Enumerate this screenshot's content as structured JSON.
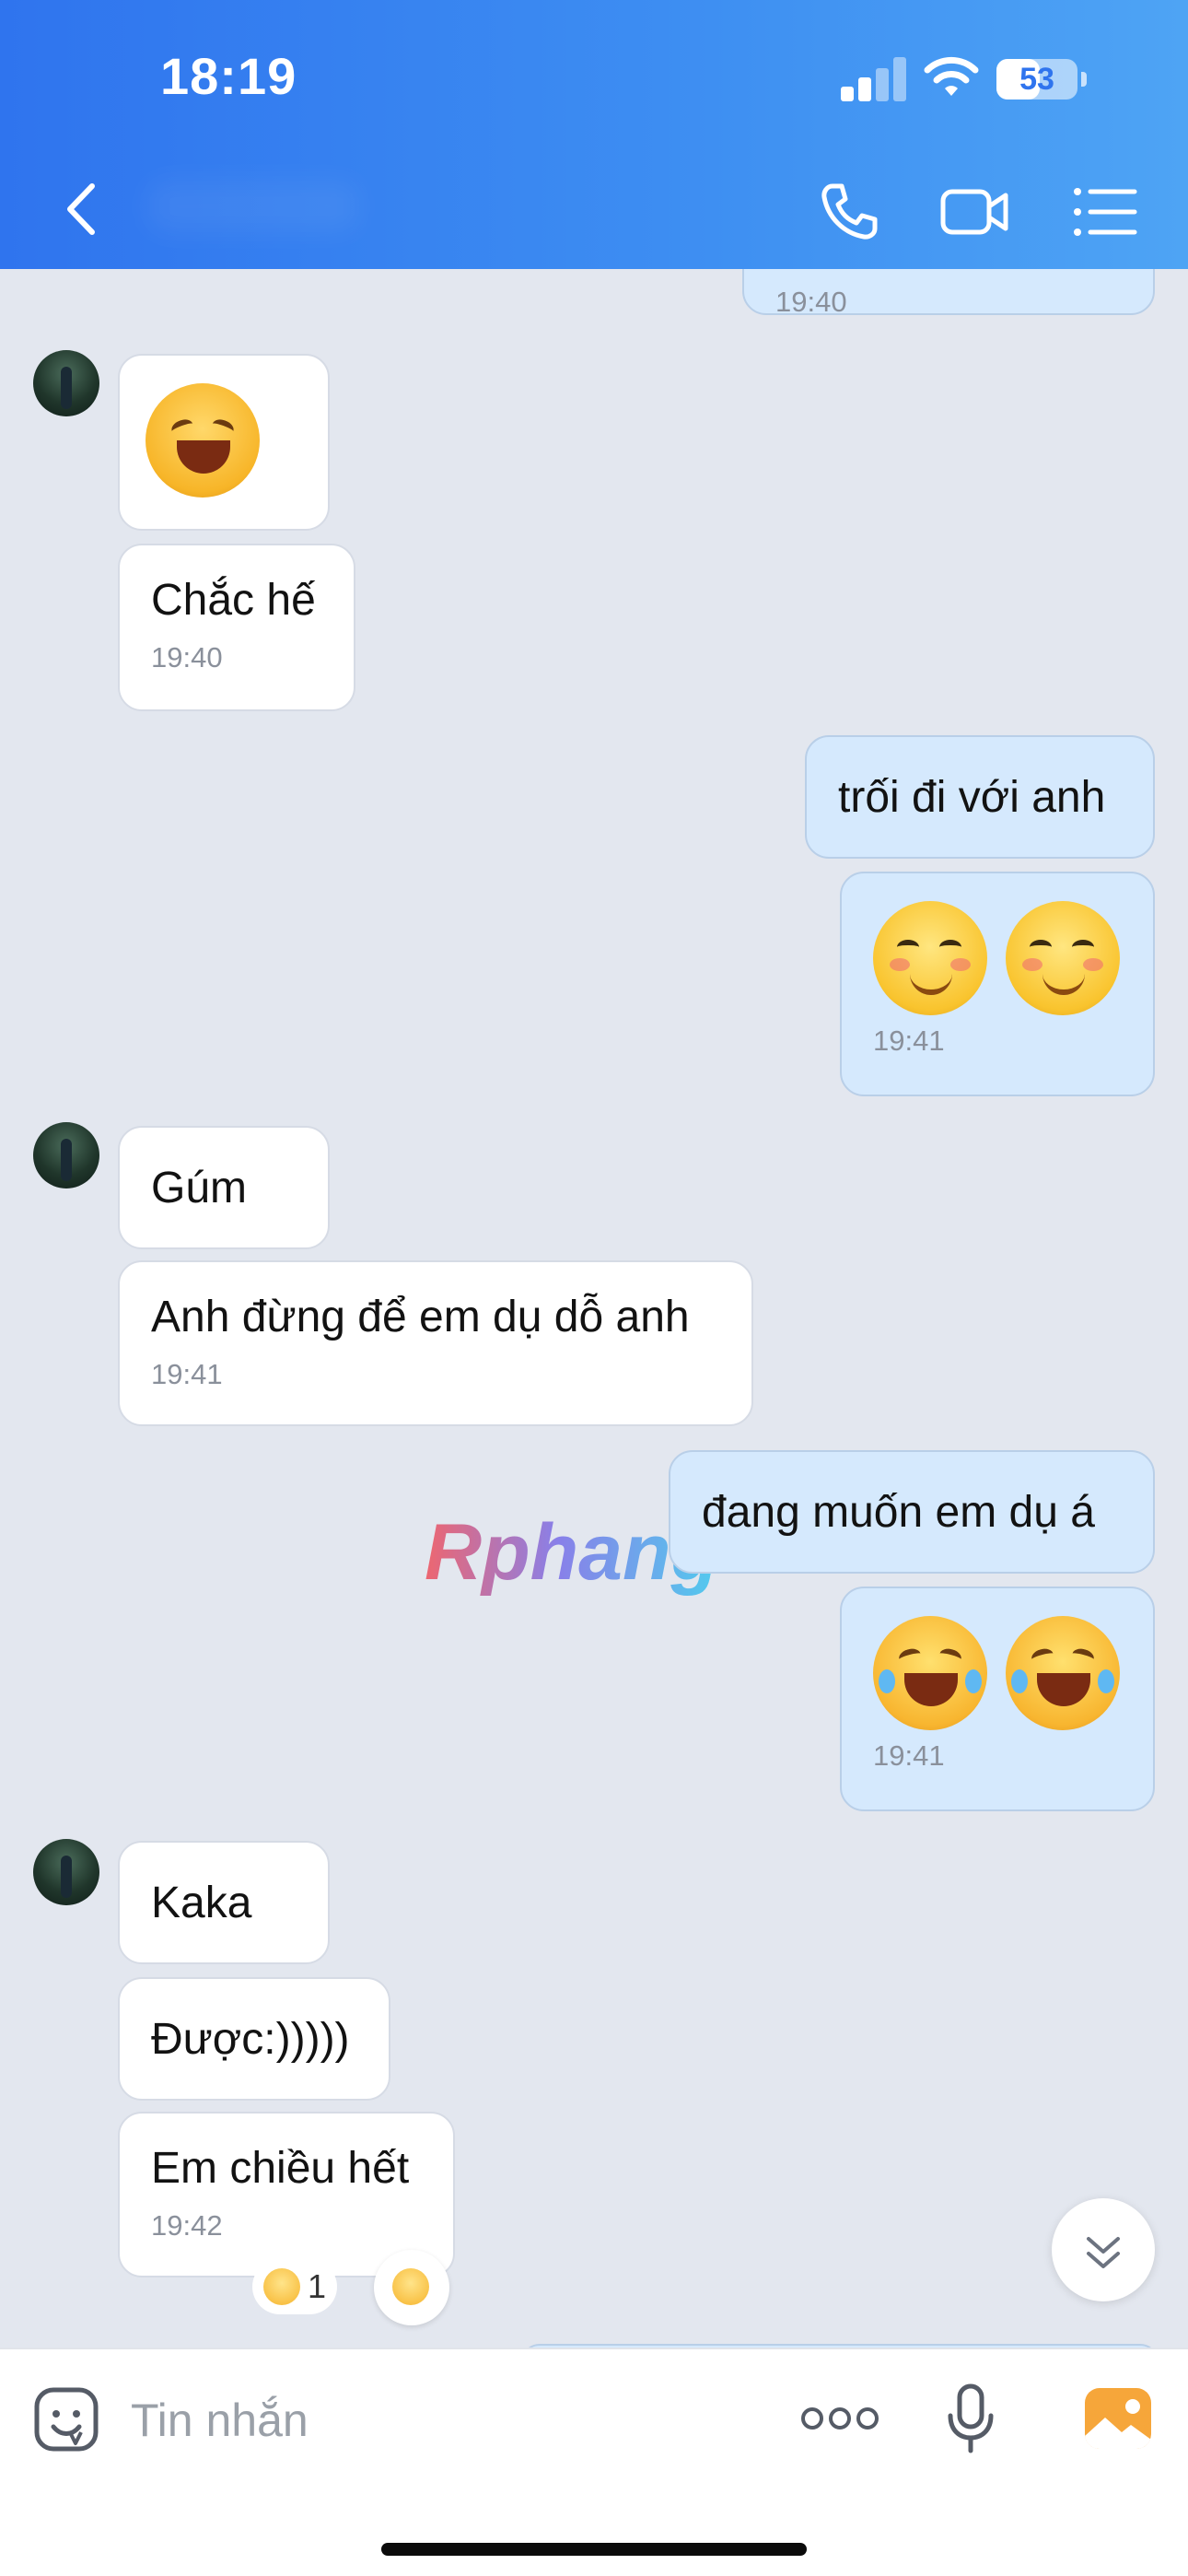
{
  "status_bar": {
    "time": "18:19",
    "battery": "53",
    "battery_level": 0.53
  },
  "header": {
    "contact_name": ""
  },
  "messages": [
    {
      "time": "19:40"
    },
    {
      "time": "19:40",
      "text": "Chắc hế"
    },
    {
      "text": "trối đi với anh"
    },
    {
      "time": "19:41"
    },
    {
      "text": "Gúm"
    },
    {
      "text": "Anh đừng để em dụ dỗ anh",
      "time": "19:41"
    },
    {
      "text": "đang muốn em dụ á"
    },
    {
      "time": "19:41"
    },
    {
      "text": "Kaka"
    },
    {
      "text": "Được:)))))"
    },
    {
      "text": "Em chiều hết",
      "time": "19:42"
    }
  ],
  "reaction": {
    "count": "1",
    "icon": "astonished-emoji-icon"
  },
  "watermark": "Rphang",
  "input": {
    "placeholder": "Tin nhắn",
    "value": ""
  },
  "colors": {
    "header_start": "#2f74ee",
    "header_end": "#4ea4f4",
    "outgoing_bubble": "#d5e9fd",
    "incoming_bubble": "#ffffff",
    "chat_background": "#e3e7ef",
    "image_button": "#f6a63a"
  }
}
